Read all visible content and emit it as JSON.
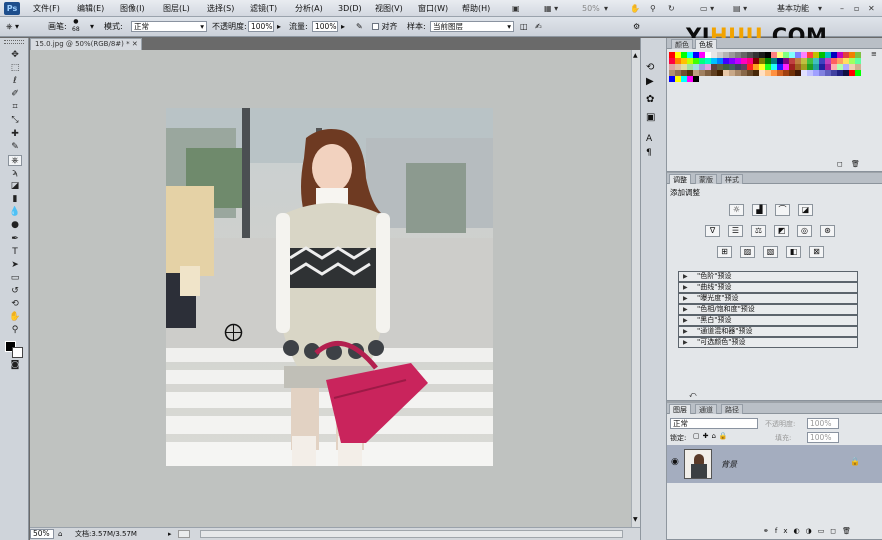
{
  "menubar": {
    "logo": "Ps",
    "items": [
      "文件(F)",
      "编辑(E)",
      "图像(I)",
      "图层(L)",
      "选择(S)",
      "滤镜(T)",
      "分析(A)",
      "3D(D)",
      "视图(V)",
      "窗口(W)",
      "帮助(H)"
    ],
    "zoom": "50%",
    "workspace": "基本功能"
  },
  "watermark": {
    "part1": "YI",
    "part2": "HUU",
    "part3": ".COM"
  },
  "options": {
    "brush_label": "画笔:",
    "brush_size": "68",
    "mode_label": "模式:",
    "mode_value": "正常",
    "opacity_label": "不透明度:",
    "opacity_value": "100%",
    "flow_label": "流量:",
    "flow_value": "100%",
    "align_label": "对齐",
    "sample_label": "样本:",
    "sample_value": "当前图层"
  },
  "document": {
    "tab_title": "15.0.jpg @ 50%(RGB/8#) *",
    "zoom": "50%",
    "doc_info": "文档:3.57M/3.57M"
  },
  "swatches_panel": {
    "tabs": [
      "颜色",
      "色板"
    ],
    "colors": [
      "#ff0000",
      "#ffff00",
      "#00ff00",
      "#00ffff",
      "#0000ff",
      "#ff00ff",
      "#ffffff",
      "#e6e6e6",
      "#cccccc",
      "#b3b3b3",
      "#999999",
      "#808080",
      "#666666",
      "#4d4d4d",
      "#333333",
      "#1a1a1a",
      "#000000",
      "#ff8080",
      "#ffff80",
      "#80ff80",
      "#80ffff",
      "#8080ff",
      "#ff80ff",
      "#ff4040",
      "#c0c000",
      "#00c000",
      "#00c0c0",
      "#0000c0",
      "#c000c0",
      "#e04040",
      "#f08000",
      "#80c040",
      "#ff0040",
      "#ff8000",
      "#ffc000",
      "#c0ff00",
      "#40ff00",
      "#00ff80",
      "#00ffc0",
      "#00c0ff",
      "#0080ff",
      "#4000ff",
      "#8000ff",
      "#c000ff",
      "#ff00c0",
      "#ff0080",
      "#800000",
      "#808000",
      "#008000",
      "#008080",
      "#000080",
      "#800080",
      "#c04040",
      "#c08040",
      "#c0c040",
      "#40c040",
      "#40c0c0",
      "#4040c0",
      "#c040c0",
      "#ff6060",
      "#ffa060",
      "#ffe060",
      "#a0ff60",
      "#60ffa0",
      "#e0a0a0",
      "#e0c0a0",
      "#e0e0a0",
      "#a0e0a0",
      "#a0e0e0",
      "#a0a0e0",
      "#e0a0e0",
      "#604040",
      "#606040",
      "#406040",
      "#406060",
      "#404060",
      "#604060",
      "#ff2020",
      "#ffa020",
      "#ffff20",
      "#20ff20",
      "#20ffff",
      "#2020ff",
      "#ff20ff",
      "#a02020",
      "#a06020",
      "#a0a020",
      "#20a020",
      "#20a0a0",
      "#2020a0",
      "#a020a0",
      "#ffb0b0",
      "#b0ffb0",
      "#b0b0ff",
      "#f0d0b0",
      "#d0b090",
      "#b09070",
      "#907050",
      "#705030",
      "#503010",
      "#c0a080",
      "#a08060",
      "#806040",
      "#604020",
      "#402000",
      "#e8c8a8",
      "#c8a888",
      "#a88868",
      "#886848",
      "#684828",
      "#482808",
      "#ffe0c0",
      "#ffc080",
      "#ff9040",
      "#d06020",
      "#a04010",
      "#703008",
      "#401804",
      "#e0e0ff",
      "#c0c0ff",
      "#a0a0ff",
      "#8080e0",
      "#6060c0",
      "#4040a0",
      "#202080",
      "#101040",
      "#ff0000",
      "#00ff00",
      "#0000ff",
      "#ffff00",
      "#00ffff",
      "#ff00ff",
      "#000000"
    ]
  },
  "adjustments_panel": {
    "tabs": [
      "调整",
      "蒙版",
      "样式"
    ],
    "heading": "添加调整",
    "icons_row1": [
      "☼",
      "▟",
      "⌒",
      "◪"
    ],
    "icons_row2": [
      "∇",
      "☰",
      "⚖",
      "◩",
      "◎",
      "⊛"
    ],
    "icons_row3": [
      "⊞",
      "▨",
      "▧",
      "◧",
      "⊠"
    ],
    "presets": [
      "\"色阶\"预设",
      "\"曲线\"预设",
      "\"曝光度\"预设",
      "\"色相/饱和度\"预设",
      "\"黑白\"预设",
      "\"通道混和器\"预设",
      "\"可选颜色\"预设"
    ]
  },
  "layers_panel": {
    "tabs": [
      "图层",
      "通道",
      "路径"
    ],
    "blend_mode": "正常",
    "opacity_label": "不透明度:",
    "opacity_value": "100%",
    "lock_label": "锁定:",
    "fill_label": "填充:",
    "fill_value": "100%",
    "layer_name": "背景"
  }
}
